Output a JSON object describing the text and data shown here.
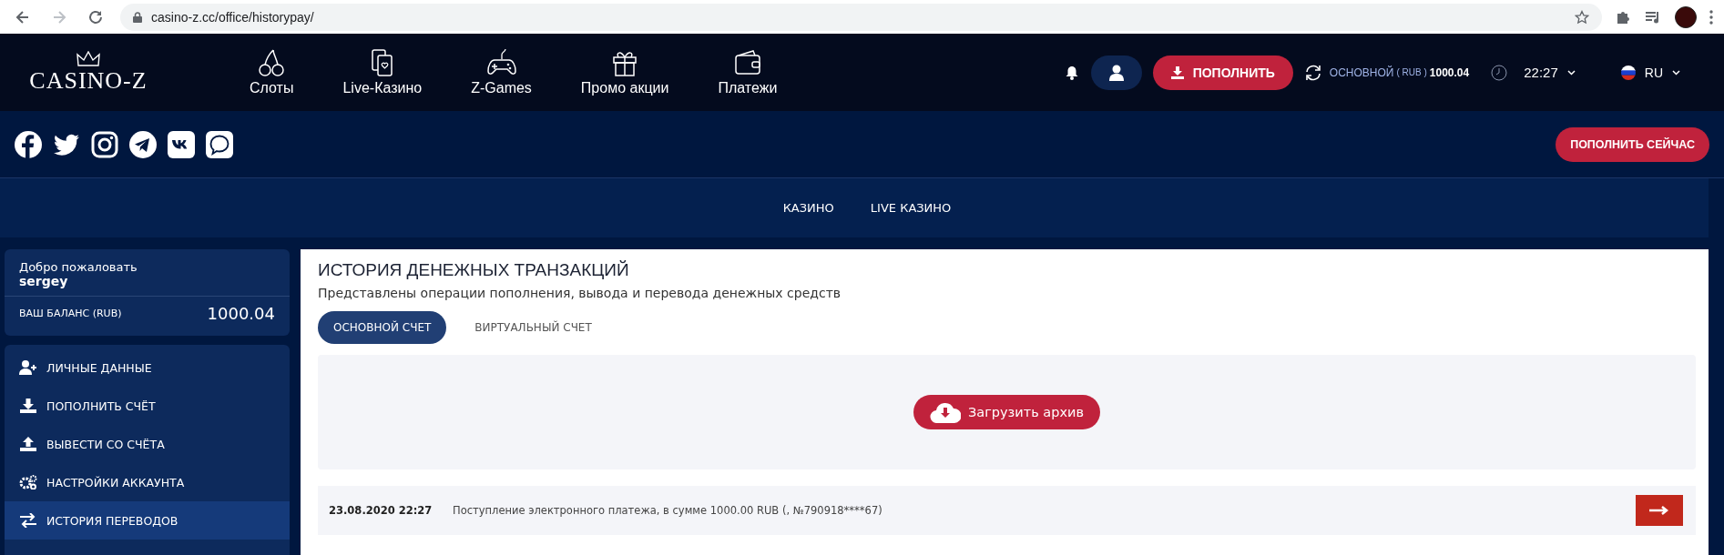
{
  "browser": {
    "back_disabled": false,
    "forward_disabled": true,
    "url": "casino-z.cc/office/historypay/"
  },
  "header": {
    "logo": "CASINO-Z",
    "nav": [
      {
        "kind": "cherry",
        "label": "Слоты"
      },
      {
        "kind": "cards",
        "label": "Live-Казино"
      },
      {
        "kind": "gamepad",
        "label": "Z-Games"
      },
      {
        "kind": "gift",
        "label": "Промо акции"
      },
      {
        "kind": "wallet",
        "label": "Платежи"
      }
    ],
    "deposit_button": "ПОПОЛНИТЬ",
    "account_label": "ОСНОВНОЙ",
    "account_currency": "( RUB )",
    "account_balance": "1000.04",
    "time": "22:27",
    "language": "RU"
  },
  "social_bar": {
    "icons": [
      {
        "kind": "facebook"
      },
      {
        "kind": "twitter"
      },
      {
        "kind": "instagram"
      },
      {
        "kind": "telegram"
      },
      {
        "kind": "vk"
      },
      {
        "kind": "chat"
      }
    ],
    "deposit_now_button": "ПОПОЛНИТЬ СЕЙЧАС"
  },
  "subnav": [
    "КАЗИНО",
    "LIVE КАЗИНО"
  ],
  "sidebar": {
    "welcome": "Добро пожаловать",
    "username": "sergey",
    "balance_label": "ВАШ БАЛАНС (RUB)",
    "balance": "1000.04",
    "items": [
      {
        "kind": "user",
        "label": "ЛИЧНЫЕ ДАННЫЕ",
        "selected": false
      },
      {
        "kind": "download",
        "label": "ПОПОЛНИТЬ СЧЁТ",
        "selected": false
      },
      {
        "kind": "upload",
        "label": "ВЫВЕСТИ СО СЧЁТА",
        "selected": false
      },
      {
        "kind": "gears",
        "label": "НАСТРОЙКИ АККАУНТА",
        "selected": false
      },
      {
        "kind": "transfer",
        "label": "ИСТОРИЯ ПЕРЕВОДОВ",
        "selected": true
      }
    ]
  },
  "main": {
    "title": "ИСТОРИЯ ДЕНЕЖНЫХ ТРАНЗАКЦИЙ",
    "subtitle": "Представлены операции пополнения, вывода и перевода денежных средств",
    "tabs": [
      {
        "label": "ОСНОВНОЙ СЧЕТ",
        "selected": true
      },
      {
        "label": "ВИРТУАЛЬНЫЙ СЧЕТ",
        "selected": false
      }
    ],
    "archive_button": "Загрузить архив",
    "transactions": [
      {
        "date": "23.08.2020 22:27",
        "description": "Поступление электронного платежа, в сумме 1000.00 RUB (, №790918****67)"
      }
    ]
  }
}
